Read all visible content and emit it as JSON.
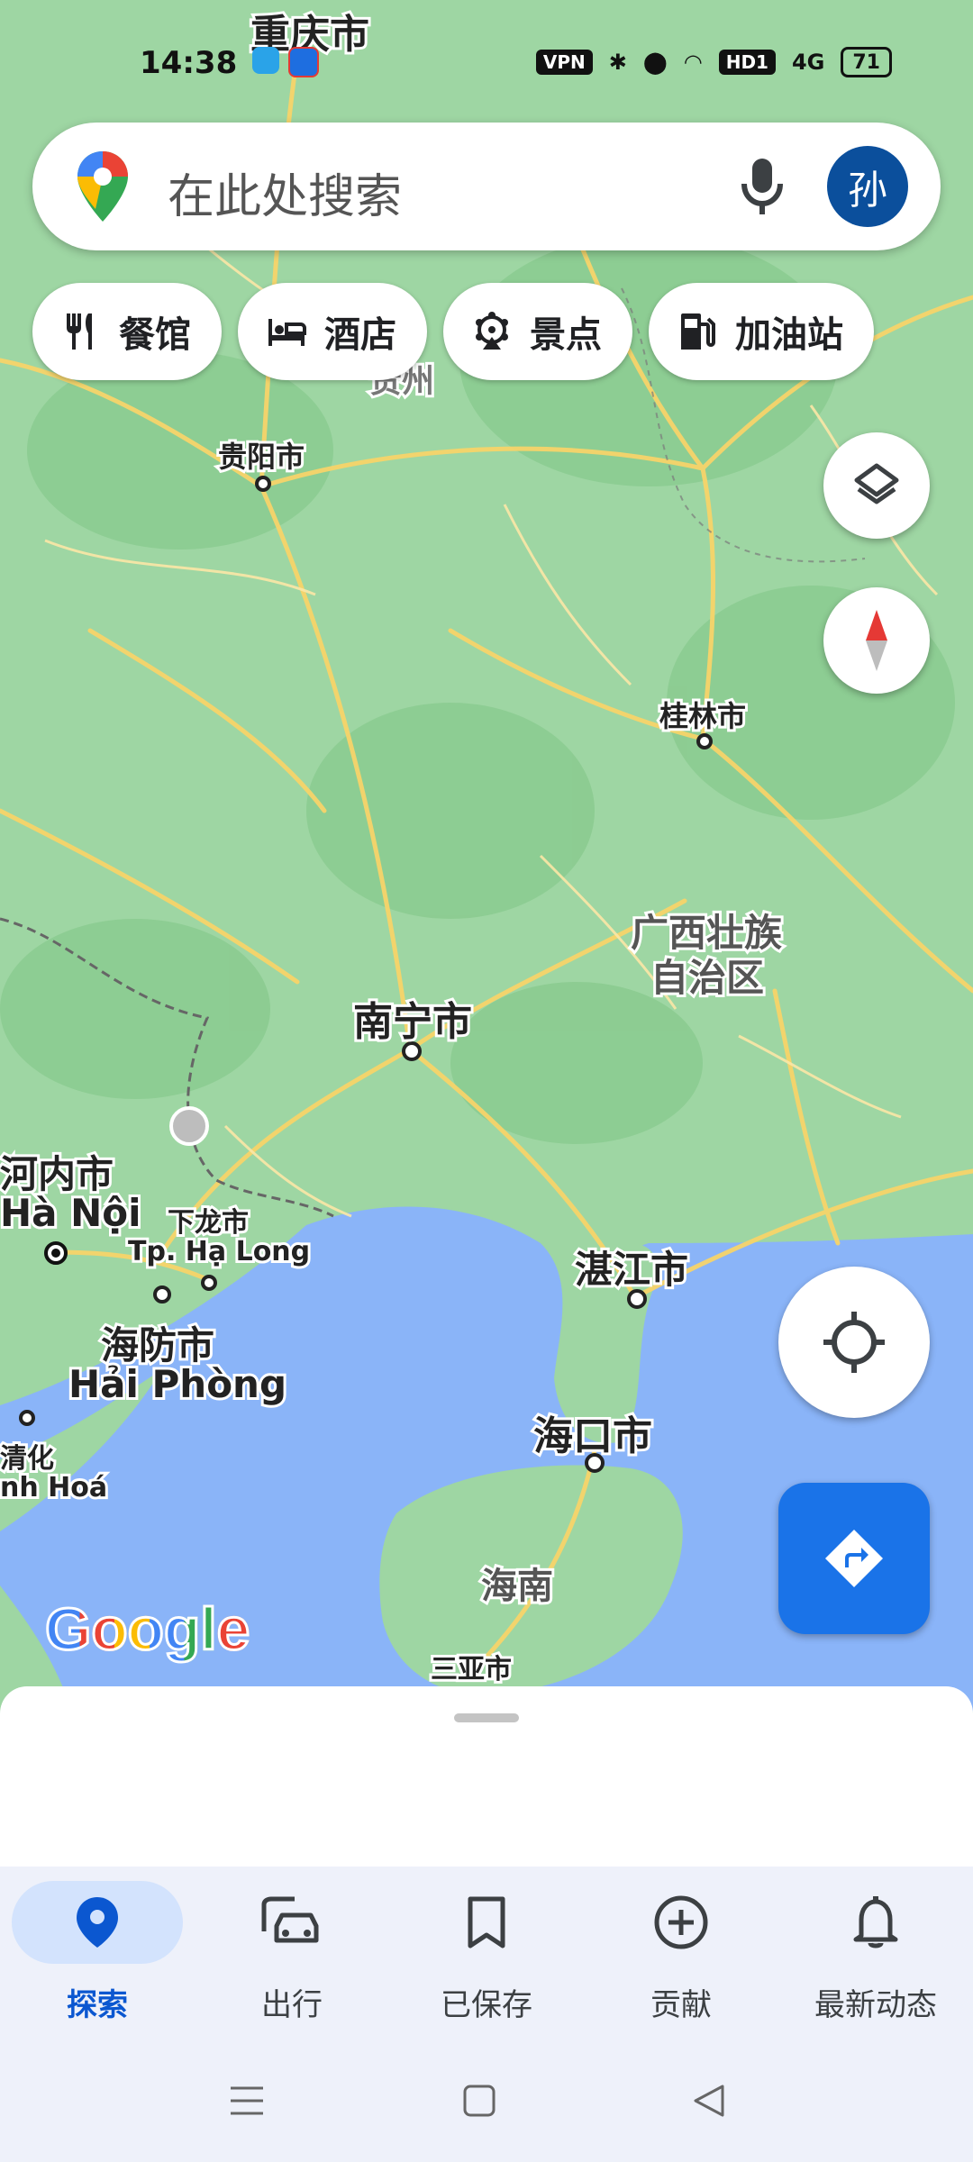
{
  "status_bar": {
    "time": "14:38",
    "vpn": "VPN",
    "network": "HD1",
    "signal": "4G",
    "battery": "71"
  },
  "search": {
    "placeholder": "在此处搜索",
    "avatar_initial": "孙"
  },
  "chips": [
    {
      "label": "餐馆",
      "icon": "restaurant-icon"
    },
    {
      "label": "酒店",
      "icon": "hotel-icon"
    },
    {
      "label": "景点",
      "icon": "attractions-icon"
    },
    {
      "label": "加油站",
      "icon": "gas-station-icon"
    }
  ],
  "map_labels": {
    "chongqing": "重庆市",
    "guizhou": "贵州",
    "guiyang": "贵阳市",
    "guilin": "桂林市",
    "guangxi_1": "广西壮族",
    "guangxi_2": "自治区",
    "nanning": "南宁市",
    "hanoi_cn": "河内市",
    "hanoi_vn": "Hà Nội",
    "halong_cn": "下龙市",
    "halong_vn": "Tp. Hạ Long",
    "haiphong_cn": "海防市",
    "haiphong_vn": "Hải Phòng",
    "zhanjiang": "湛江市",
    "haikou": "海口市",
    "hainan": "海南",
    "sanya": "三亚市",
    "thanhhoa_cn": "清化",
    "thanhhoa_vn": "nh Hoá"
  },
  "google_logo": "Google",
  "bottom_nav": [
    {
      "label": "探索",
      "icon": "explore-pin-icon",
      "active": true
    },
    {
      "label": "出行",
      "icon": "commute-car-icon",
      "active": false
    },
    {
      "label": "已保存",
      "icon": "bookmark-icon",
      "active": false
    },
    {
      "label": "贡献",
      "icon": "add-circle-icon",
      "active": false
    },
    {
      "label": "最新动态",
      "icon": "bell-icon",
      "active": false
    }
  ],
  "colors": {
    "land": "#9ed6a3",
    "water": "#8ab4f8",
    "road": "#f7d46a",
    "accent": "#1a73e8",
    "avatar": "#0b4f9c"
  }
}
